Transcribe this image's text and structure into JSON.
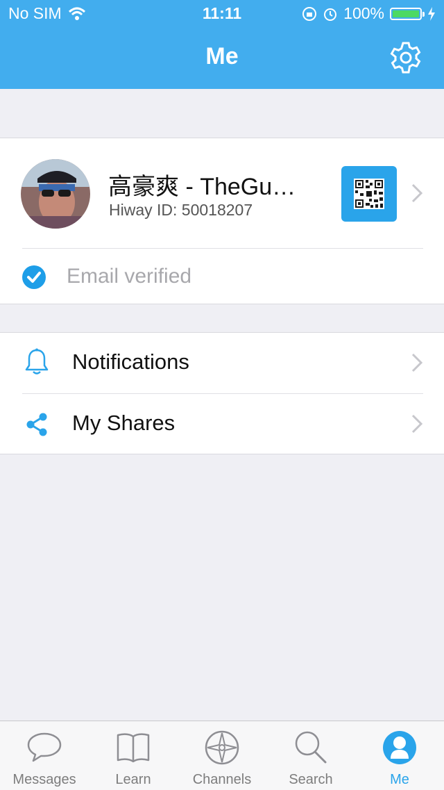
{
  "status_bar": {
    "carrier": "No SIM",
    "time": "11:11",
    "battery": "100%"
  },
  "nav": {
    "title": "Me",
    "settings_icon": "gear-icon"
  },
  "profile": {
    "name": "高豪爽 - TheGu…",
    "hiway_id": "Hiway ID: 50018207",
    "email_status": "Email verified"
  },
  "menu": {
    "items": [
      {
        "label": "Notifications",
        "icon": "bell-icon"
      },
      {
        "label": "My Shares",
        "icon": "share-icon"
      }
    ]
  },
  "tabs": [
    {
      "label": "Messages",
      "icon": "chat-bubble-icon"
    },
    {
      "label": "Learn",
      "icon": "book-icon"
    },
    {
      "label": "Channels",
      "icon": "compass-icon"
    },
    {
      "label": "Search",
      "icon": "magnifier-icon"
    },
    {
      "label": "Me",
      "icon": "person-icon",
      "active": true
    }
  ],
  "colors": {
    "accent": "#42adee",
    "active_tab": "#2aa4ea",
    "battery": "#4cd964"
  }
}
